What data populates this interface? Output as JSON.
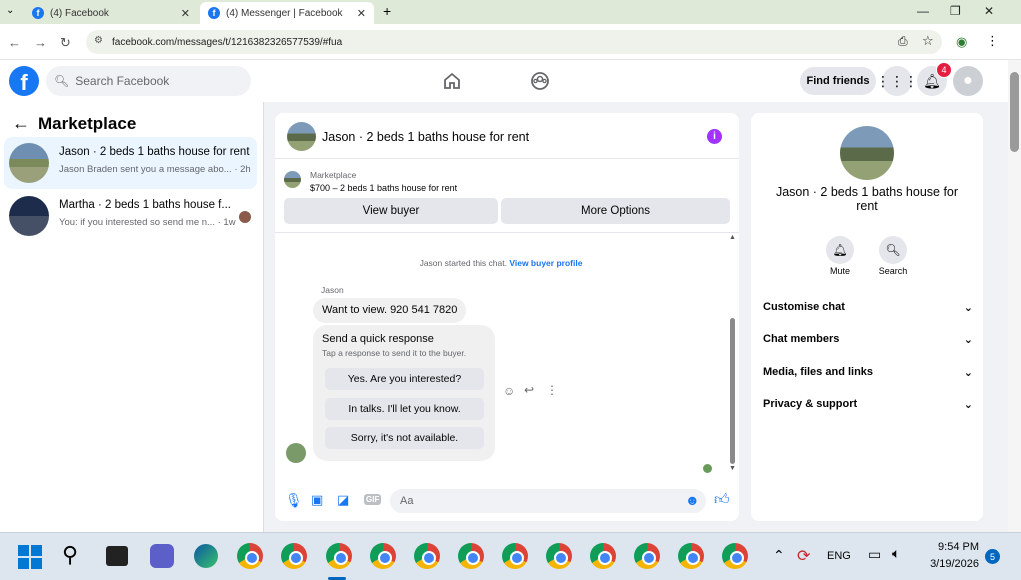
{
  "browser": {
    "tabs": [
      {
        "title": "(4) Facebook",
        "active": false
      },
      {
        "title": "(4) Messenger | Facebook",
        "active": true
      }
    ],
    "url": "facebook.com/messages/t/1216382326577539/#fua"
  },
  "header": {
    "search_placeholder": "Search Facebook",
    "find_friends": "Find friends",
    "notification_count": "4"
  },
  "sidebar": {
    "title": "Marketplace",
    "conversations": [
      {
        "name": "Jason · 2 beds 1 baths house for rent",
        "preview": "Jason Braden sent you a message abo... · 2h",
        "active": true
      },
      {
        "name": "Martha · 2 beds 1 baths house f...",
        "preview": "You: if you interested so send me n... · 1w",
        "active": false
      }
    ]
  },
  "chat": {
    "title": "Jason · 2 beds 1 baths house for rent",
    "listing_source": "Marketplace",
    "listing_desc": "$700 – 2 beds 1 baths house for rent",
    "view_buyer": "View buyer",
    "more_options": "More Options",
    "system_msg": "Jason started this chat.",
    "system_link": "View buyer profile",
    "sender": "Jason",
    "message": "Want to view. 920 541 7820",
    "quick_title": "Send a quick response",
    "quick_sub": "Tap a response to send it to the buyer.",
    "quick_replies": [
      "Yes. Are you interested?",
      "In talks. I'll let you know.",
      "Sorry, it's not available."
    ],
    "input_placeholder": "Aa"
  },
  "details": {
    "title": "Jason · 2 beds 1 baths house for rent",
    "mute": "Mute",
    "search": "Search",
    "options": [
      "Customise chat",
      "Chat members",
      "Media, files and links",
      "Privacy & support"
    ]
  },
  "taskbar": {
    "lang": "ENG",
    "time": "9:54 PM",
    "date": "3/19/2026",
    "notif": "5"
  },
  "colors": {
    "fb_blue": "#1877f2",
    "purple": "#a033ff",
    "badge_red": "#e41e3f"
  }
}
